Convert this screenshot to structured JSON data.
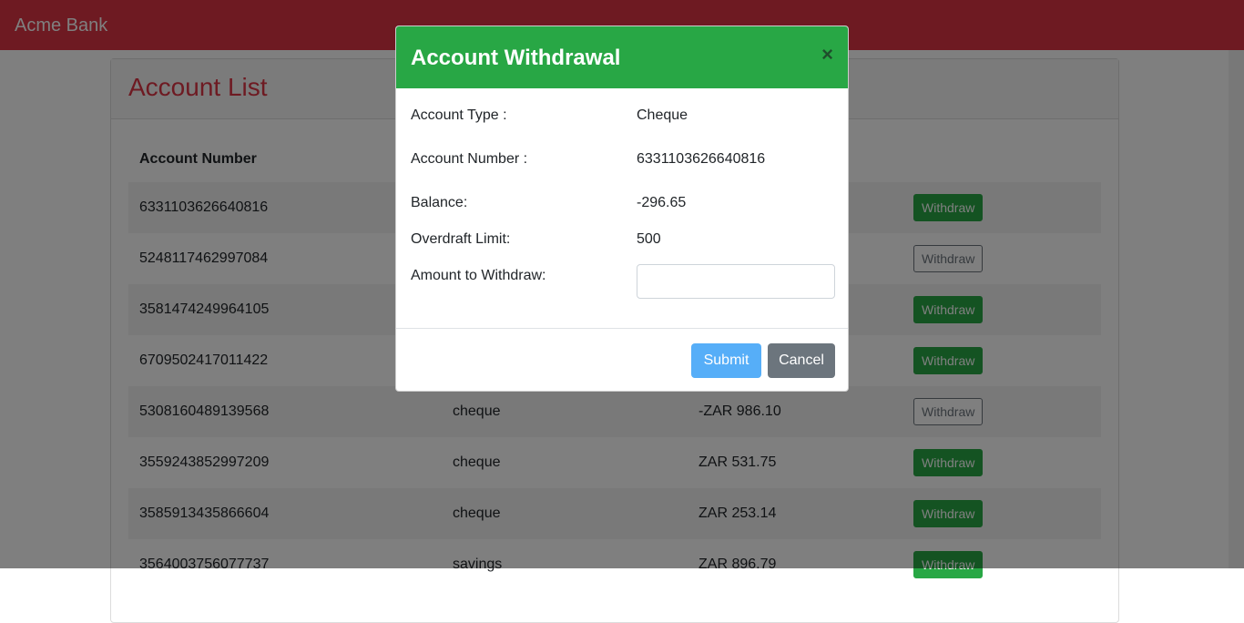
{
  "app": {
    "brand": "Acme Bank"
  },
  "page": {
    "title": "Account List"
  },
  "table": {
    "headers": {
      "account_number": "Account Number"
    },
    "button_label": "Withdraw",
    "rows": [
      {
        "number": "6331103626640816",
        "type": "",
        "balance": "",
        "withdraw_enabled": true
      },
      {
        "number": "5248117462997084",
        "type": "",
        "balance": "",
        "withdraw_enabled": false
      },
      {
        "number": "3581474249964105",
        "type": "",
        "balance": "",
        "withdraw_enabled": true
      },
      {
        "number": "6709502417011422",
        "type": "",
        "balance": "",
        "withdraw_enabled": true
      },
      {
        "number": "5308160489139568",
        "type": "cheque",
        "balance": "-ZAR 986.10",
        "withdraw_enabled": false
      },
      {
        "number": "3559243852997209",
        "type": "cheque",
        "balance": "ZAR 531.75",
        "withdraw_enabled": true
      },
      {
        "number": "3585913435866604",
        "type": "cheque",
        "balance": "ZAR 253.14",
        "withdraw_enabled": true
      },
      {
        "number": "3564003756077737",
        "type": "savings",
        "balance": "ZAR 896.79",
        "withdraw_enabled": true
      }
    ]
  },
  "modal": {
    "title": "Account Withdrawal",
    "close_symbol": "×",
    "fields": {
      "account_type_label": "Account Type :",
      "account_type_value": "Cheque",
      "account_number_label": "Account Number :",
      "account_number_value": "6331103626640816",
      "balance_label": "Balance:",
      "balance_value": "-296.65",
      "overdraft_label": "Overdraft Limit:",
      "overdraft_value": "500",
      "amount_label": "Amount to Withdraw:",
      "amount_value": ""
    },
    "submit_label": "Submit",
    "cancel_label": "Cancel"
  },
  "colors": {
    "navbar": "#dc3545",
    "modal_header": "#28a745",
    "submit": "#56aef8",
    "cancel": "#6c757d"
  }
}
